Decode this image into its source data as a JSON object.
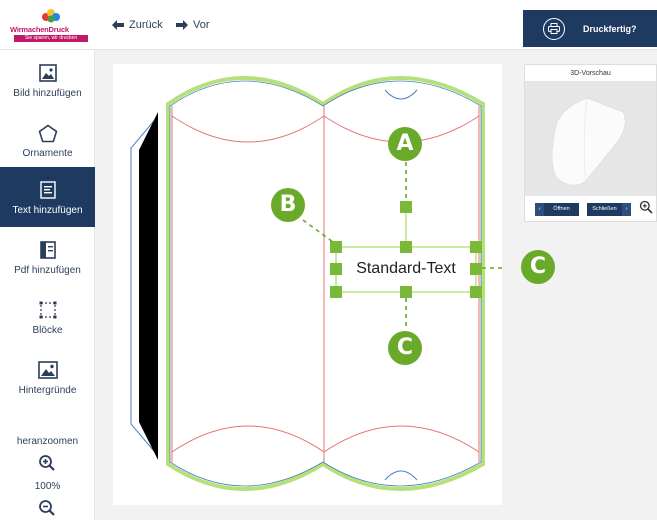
{
  "header": {
    "logo_brand": "WirmachenDruck",
    "logo_tagline": "Sie sparen, wir drucken",
    "back_label": "Zurück",
    "forward_label": "Vor",
    "print_label": "Druckfertig?",
    "print_icon": "printer-icon"
  },
  "sidebar": {
    "items": [
      {
        "label": "Bild hinzufügen",
        "icon": "image-icon"
      },
      {
        "label": "Ornamente",
        "icon": "pentagon-icon"
      },
      {
        "label": "Text hinzufügen",
        "icon": "text-icon",
        "active": true
      },
      {
        "label": "Pdf hinzufügen",
        "icon": "pdf-icon"
      },
      {
        "label": "Blöcke",
        "icon": "block-icon"
      },
      {
        "label": "Hintergründe",
        "icon": "background-icon"
      }
    ],
    "zoom_label": "heranzoomen",
    "zoom_value": "100%"
  },
  "canvas": {
    "text_element": "Standard-Text",
    "callouts": [
      "A",
      "B",
      "C",
      "C"
    ]
  },
  "preview": {
    "title": "3D-Vorschau",
    "open_label": "Öffnen",
    "close_label": "Schließen"
  },
  "colors": {
    "navy": "#1f3a61",
    "callout_green": "#6aaa2a",
    "handle_green": "#7ab83a",
    "brand_magenta": "#c2186a"
  }
}
